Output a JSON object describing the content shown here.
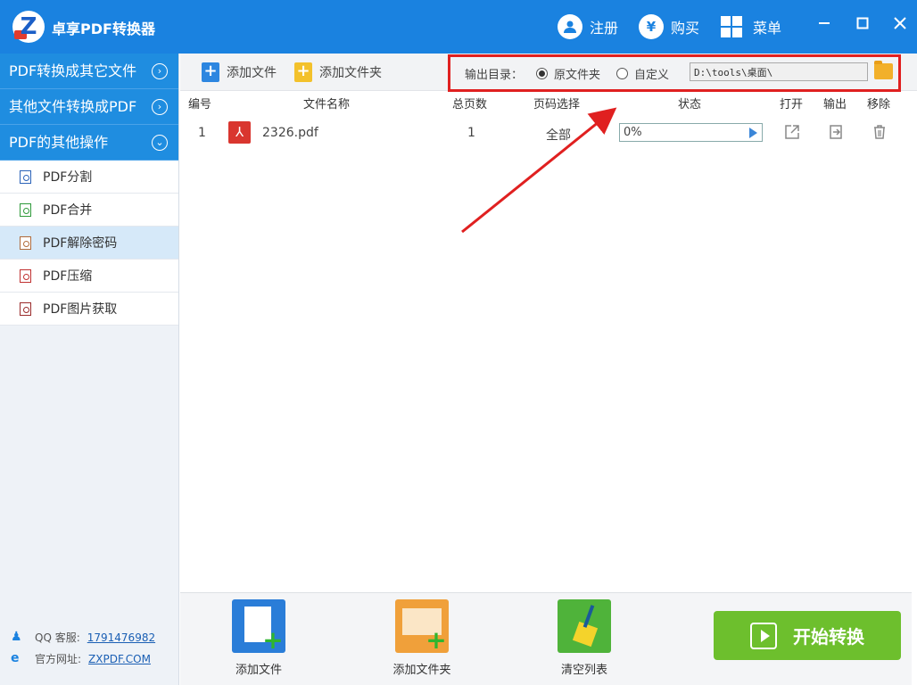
{
  "app": {
    "title": "卓享PDF转换器"
  },
  "titlebar": {
    "register_label": "注册",
    "buy_label": "购买",
    "menu_label": "菜单",
    "buy_symbol": "¥"
  },
  "sidebar": {
    "categories": [
      {
        "label": "PDF转换成其它文件"
      },
      {
        "label": "其他文件转换成PDF"
      },
      {
        "label": "PDF的其他操作"
      }
    ],
    "items": [
      {
        "label": "PDF分割",
        "color": "#2a62b8"
      },
      {
        "label": "PDF合并",
        "color": "#2e9a3a"
      },
      {
        "label": "PDF解除密码",
        "color": "#b06a3a"
      },
      {
        "label": "PDF压缩",
        "color": "#c03030"
      },
      {
        "label": "PDF图片获取",
        "color": "#9a2a2a"
      }
    ],
    "support": {
      "qq_label": "QQ 客服:",
      "qq_number": "1791476982",
      "site_label": "官方网址:",
      "site_url": "ZXPDF.COM"
    }
  },
  "toolbar": {
    "add_file_label": "添加文件",
    "add_folder_label": "添加文件夹",
    "output_dir_label": "输出目录：",
    "radio_original_label": "原文件夹",
    "radio_custom_label": "自定义",
    "selected_radio": "原文件夹",
    "output_path": "D:\\tools\\桌面\\"
  },
  "table": {
    "headers": {
      "index": "编号",
      "filename": "文件名称",
      "total_pages": "总页数",
      "page_select": "页码选择",
      "status": "状态",
      "open": "打开",
      "output": "输出",
      "remove": "移除"
    },
    "rows": [
      {
        "index": "1",
        "filename": "2326.pdf",
        "total_pages": "1",
        "page_select": "全部",
        "progress_text": "0%",
        "progress_value": 0
      }
    ]
  },
  "bottom": {
    "add_file_label": "添加文件",
    "add_folder_label": "添加文件夹",
    "clear_list_label": "清空列表",
    "start_label": "开始转换"
  },
  "colors": {
    "accent": "#1a82e0",
    "highlight_box": "#e02020",
    "start_button": "#6dbf2d"
  }
}
